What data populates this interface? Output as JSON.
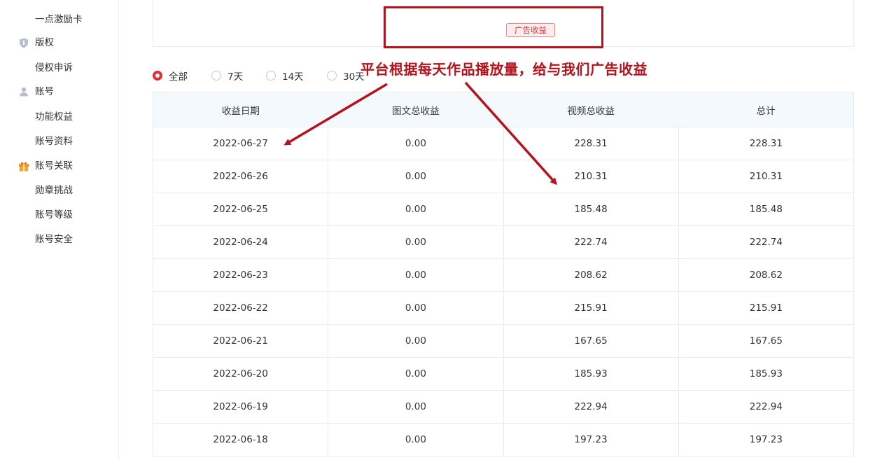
{
  "sidebar": {
    "items": [
      {
        "label": "一点激励卡",
        "kind": "sub"
      },
      {
        "label": "版权",
        "kind": "group",
        "icon": "shield-icon"
      },
      {
        "label": "侵权申诉",
        "kind": "sub"
      },
      {
        "label": "账号",
        "kind": "group",
        "icon": "user-icon"
      },
      {
        "label": "功能权益",
        "kind": "sub"
      },
      {
        "label": "账号资料",
        "kind": "sub"
      },
      {
        "label": "账号关联",
        "kind": "group",
        "icon": "gift-icon"
      },
      {
        "label": "勋章挑战",
        "kind": "sub"
      },
      {
        "label": "账号等级",
        "kind": "sub"
      },
      {
        "label": "账号安全",
        "kind": "sub"
      }
    ]
  },
  "top": {
    "ad_tag": "广告收益"
  },
  "filters": {
    "options": [
      "全部",
      "7天",
      "14天",
      "30天"
    ],
    "selected": "全部"
  },
  "annotation": {
    "text": "平台根据每天作品播放量，给与我们广告收益"
  },
  "table": {
    "headers": [
      "收益日期",
      "图文总收益",
      "视频总收益",
      "总计"
    ],
    "rows": [
      [
        "2022-06-27",
        "0.00",
        "228.31",
        "228.31"
      ],
      [
        "2022-06-26",
        "0.00",
        "210.31",
        "210.31"
      ],
      [
        "2022-06-25",
        "0.00",
        "185.48",
        "185.48"
      ],
      [
        "2022-06-24",
        "0.00",
        "222.74",
        "222.74"
      ],
      [
        "2022-06-23",
        "0.00",
        "208.62",
        "208.62"
      ],
      [
        "2022-06-22",
        "0.00",
        "215.91",
        "215.91"
      ],
      [
        "2022-06-21",
        "0.00",
        "167.65",
        "167.65"
      ],
      [
        "2022-06-20",
        "0.00",
        "185.93",
        "185.93"
      ],
      [
        "2022-06-19",
        "0.00",
        "222.94",
        "222.94"
      ],
      [
        "2022-06-18",
        "0.00",
        "197.23",
        "197.23"
      ]
    ]
  },
  "colors": {
    "accent": "#e02e3a",
    "annotation": "#b5121b",
    "header_bg": "#f4f9fd",
    "border": "#ebebeb"
  }
}
